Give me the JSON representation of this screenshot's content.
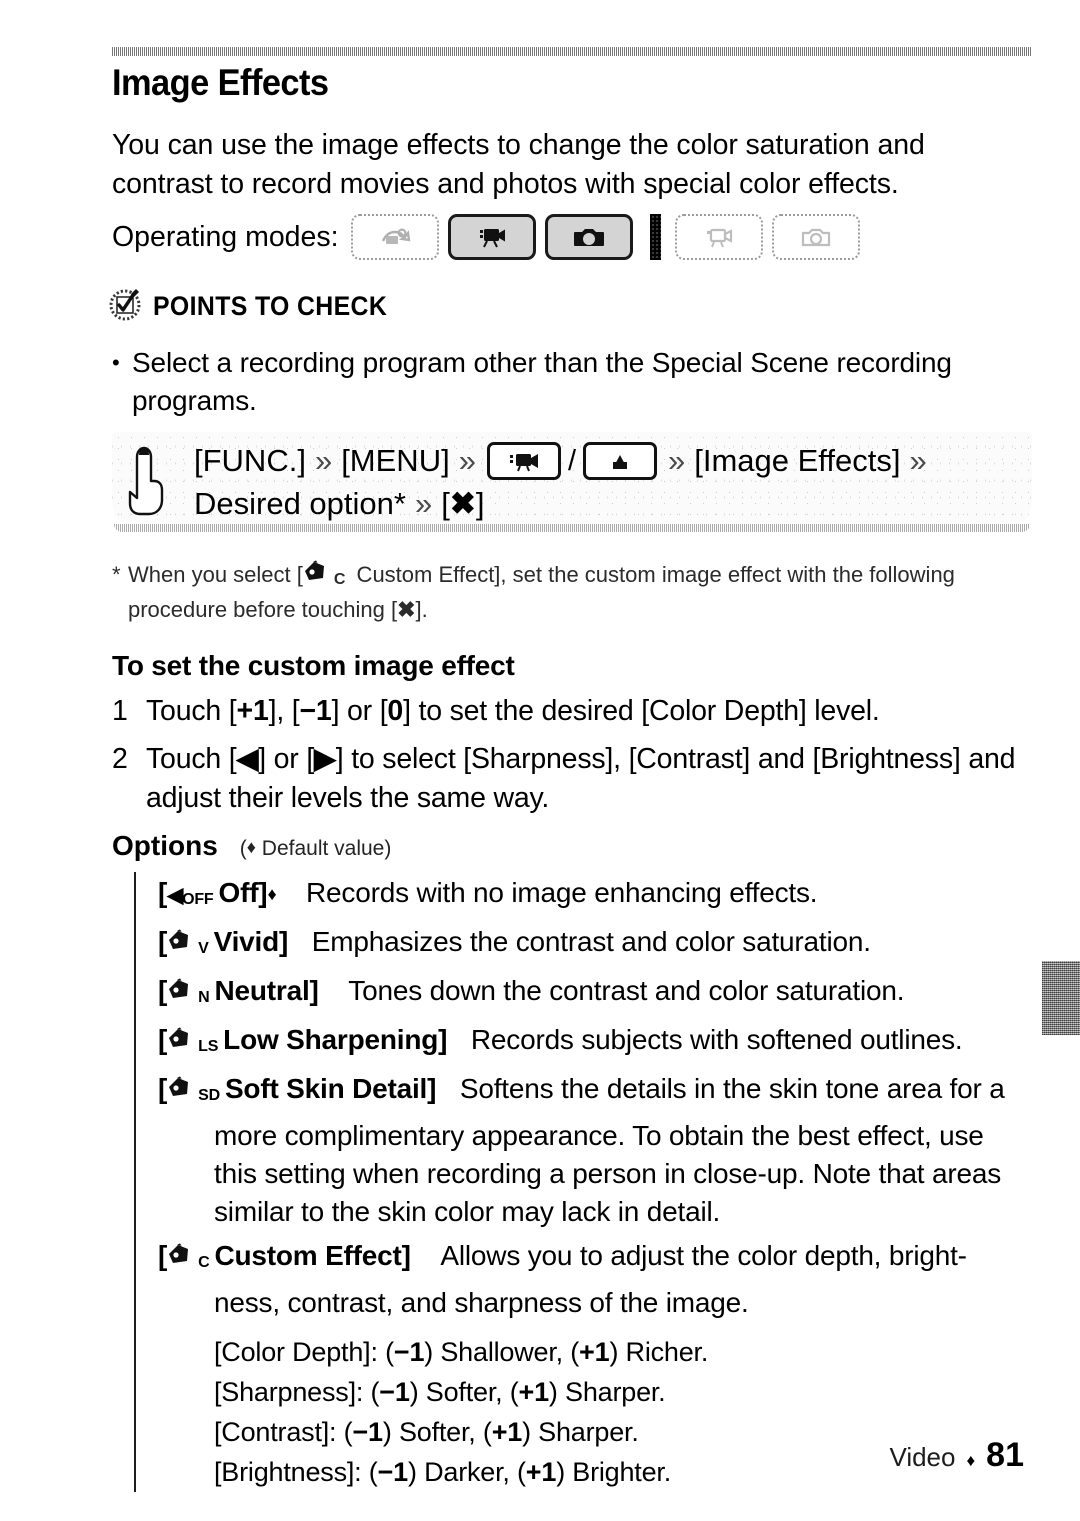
{
  "page": {
    "title": "Image Effects",
    "intro": "You can use the image effects to change the color saturation and contrast to record movies and photos with special color effects.",
    "footer_section": "Video",
    "footer_diamond": "♦",
    "footer_page": "81"
  },
  "operating_modes": {
    "label": "Operating modes:",
    "boxes": [
      {
        "icon": "auto-mode-icon",
        "state": "inactive"
      },
      {
        "icon": "movie-camera-icon",
        "state": "active"
      },
      {
        "icon": "photo-camera-icon",
        "state": "active"
      },
      {
        "icon": "movie-playback-icon",
        "state": "inactive"
      },
      {
        "icon": "photo-playback-icon",
        "state": "inactive"
      }
    ]
  },
  "points_to_check": {
    "icon": "check-seal-icon",
    "title": "POINTS TO CHECK",
    "bullet_dot": "•",
    "bullets": [
      "Select a recording program other than the Special Scene recording programs."
    ]
  },
  "procedure": {
    "hand_icon": "pointing-hand-icon",
    "arrow": "»",
    "line1": {
      "func": "[FUNC.]",
      "menu": "[MENU]",
      "movie_btn_icon": "movie-camera-icon",
      "slash": "/",
      "photo_btn_icon": "photo-camera-icon",
      "target": "[Image Effects]"
    },
    "line2": {
      "desired": "Desired option*",
      "close": "[",
      "close_glyph": "✖",
      "close_end": "]"
    }
  },
  "footnote": {
    "star": "*",
    "before_icon": "When you select [",
    "icon": "palette-icon",
    "sub": "C",
    "after_icon": " Custom Effect], set the custom image effect with the following procedure before touching [",
    "x_glyph": "✖",
    "tail": "]."
  },
  "custom_effect": {
    "heading": "To set the custom image effect",
    "steps": [
      {
        "num": "1",
        "parts": [
          "Touch [",
          "+1",
          "], [",
          "−1",
          "] or [",
          "0",
          "] to set the desired [Color Depth] level."
        ]
      },
      {
        "num": "2",
        "parts": [
          "Touch [",
          "◀",
          "] or [",
          "▶",
          "] to select [Sharpness], [Contrast] and [Brightness] and adjust their levels the same way."
        ]
      }
    ]
  },
  "options": {
    "heading": "Options",
    "default_note_open": "(",
    "default_note_diamond": "♦",
    "default_note_text": " Default value)",
    "items": [
      {
        "icon": "off-palette-icon",
        "icon_label": "OFF",
        "name": "Off]",
        "open_bracket": "[",
        "default_marker": "♦",
        "desc": "Records with no image enhancing effects."
      },
      {
        "icon": "palette-icon",
        "icon_label": "V",
        "name": "Vivid]",
        "open_bracket": "[",
        "default_marker": "",
        "desc": "Emphasizes the contrast and color saturation."
      },
      {
        "icon": "palette-icon",
        "icon_label": "N",
        "name": "Neutral]",
        "open_bracket": "[",
        "default_marker": "",
        "desc": "Tones down the contrast and color saturation."
      },
      {
        "icon": "palette-icon",
        "icon_label": "LS",
        "name": "Low Sharpening]",
        "open_bracket": "[",
        "default_marker": "",
        "desc": "Records subjects with softened outlines."
      },
      {
        "icon": "palette-icon",
        "icon_label": "SD",
        "name": "Soft Skin Detail]",
        "open_bracket": "[",
        "default_marker": "",
        "desc": "Softens the details in the skin tone area for a",
        "continuation": "more complimentary appearance. To obtain the best effect, use this setting when recording a person in close-up. Note that areas similar to the skin color may lack in detail."
      },
      {
        "icon": "palette-icon",
        "icon_label": "C",
        "name": "Custom Effect]",
        "open_bracket": "[",
        "default_marker": "",
        "desc": "Allows you to adjust the color depth, bright-",
        "continuation": "ness, contrast, and sharpness of the image."
      }
    ],
    "parameters": [
      {
        "label": "[Color Depth]:",
        "minus": "−1",
        "minus_word": ") Shallower, (",
        "plus": "+1",
        "plus_word": ") Richer.",
        "open": "("
      },
      {
        "label": "[Sharpness]:",
        "minus": "−1",
        "minus_word": ") Softer, (",
        "plus": "+1",
        "plus_word": ") Sharper.",
        "open": "("
      },
      {
        "label": "[Contrast]:",
        "minus": "−1",
        "minus_word": ") Softer, (",
        "plus": "+1",
        "plus_word": ") Sharper.",
        "open": "("
      },
      {
        "label": "[Brightness]:",
        "minus": "−1",
        "minus_word": ") Darker, (",
        "plus": "+1",
        "plus_word": ") Brighter.",
        "open": "("
      }
    ]
  },
  "edge_tab": {
    "name": "chapter-edge-marker"
  }
}
